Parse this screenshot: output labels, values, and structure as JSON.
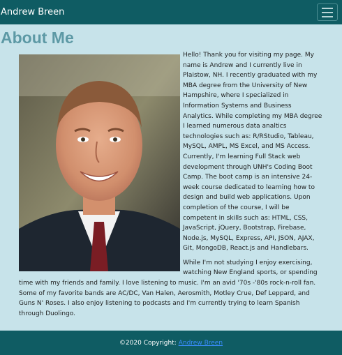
{
  "navbar": {
    "brand": "Andrew Breen",
    "toggle_icon": "hamburger-menu-icon"
  },
  "about": {
    "title": "About Me",
    "photo_icon": "profile-photo",
    "paragraph1": "Hello! Thank you for visiting my page. My name is Andrew and I currently live in Plaistow, NH. I recently graduated with my MBA degree from the University of New Hampshire, where I specialized in Information Systems and Business Analytics. While completing my MBA degree I learned numerous data analtics technologies such as: R/RStudio, Tableau, MySQL, AMPL, MS Excel, and MS Access. Currently, I'm learning Full Stack web development through UNH's Coding Boot Camp. The boot camp is an intensive 24-week course dedicated to learning how to design and build web applications. Upon completion of the course, I will be competent in skills such as: HTML, CSS, JavaScript, jQuery, Bootstrap, Firebase, Node.js, MySQL, Express, API, JSON, AJAX, Git, MongoDB, React.js and Handlebars.",
    "paragraph2": "While I'm not studying I enjoy exercising, watching New England sports, or spending time with my friends and family. I love listening to music. I'm an avid '70s -'80s rock-n-roll fan. Some of my favorite bands are AC/DC, Van Halen, Aerosmith, Motley Crue, Def Leppard, and Guns N' Roses. I also enjoy listening to podcasts and I'm currently trying to learn Spanish through Duolingo."
  },
  "footer": {
    "copyright": "©2020 Copyright:",
    "link_text": "Andrew Breen"
  },
  "colors": {
    "navbar": "#0f5c63",
    "background": "#c7e3ea",
    "title": "#5d99a5",
    "link": "#3a8dff"
  }
}
